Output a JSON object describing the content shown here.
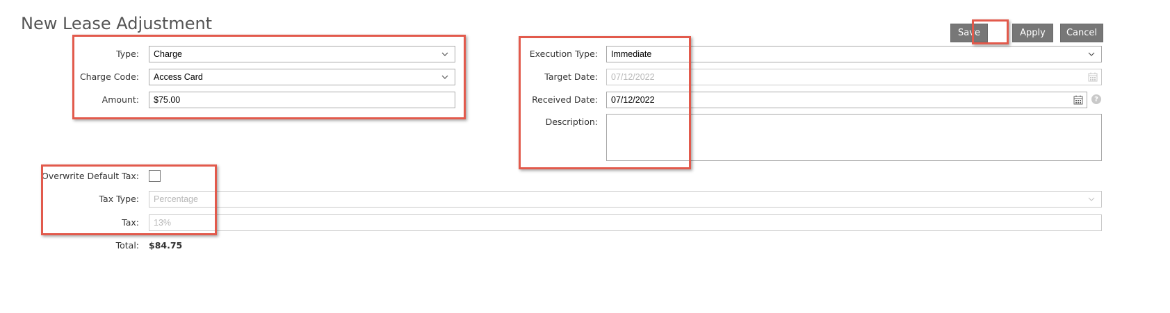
{
  "page": {
    "title": "New Lease Adjustment"
  },
  "toolbar": {
    "save_label": "Save",
    "apply_label": "Apply",
    "cancel_label": "Cancel"
  },
  "form": {
    "type": {
      "label": "Type:",
      "value": "Charge"
    },
    "charge_code": {
      "label": "Charge Code:",
      "value": "Access Card"
    },
    "amount": {
      "label": "Amount:",
      "value": "$75.00"
    },
    "execution_type": {
      "label": "Execution Type:",
      "value": "Immediate"
    },
    "target_date": {
      "label": "Target Date:",
      "value": "07/12/2022"
    },
    "received_date": {
      "label": "Received Date:",
      "value": "07/12/2022"
    },
    "description": {
      "label": "Description:",
      "value": ""
    },
    "overwrite_default_tax": {
      "label": "Overwrite Default Tax:",
      "checked": false
    },
    "tax_type": {
      "label": "Tax Type:",
      "value": "Percentage"
    },
    "tax": {
      "label": "Tax:",
      "value": "13%"
    },
    "total": {
      "label": "Total:",
      "value": "$84.75"
    }
  },
  "icons": {
    "dropdown": "chevron-down-icon",
    "calendar": "calendar-icon",
    "help": "help-icon"
  },
  "colors": {
    "highlight": "#e25a4c",
    "button": "#777777"
  }
}
